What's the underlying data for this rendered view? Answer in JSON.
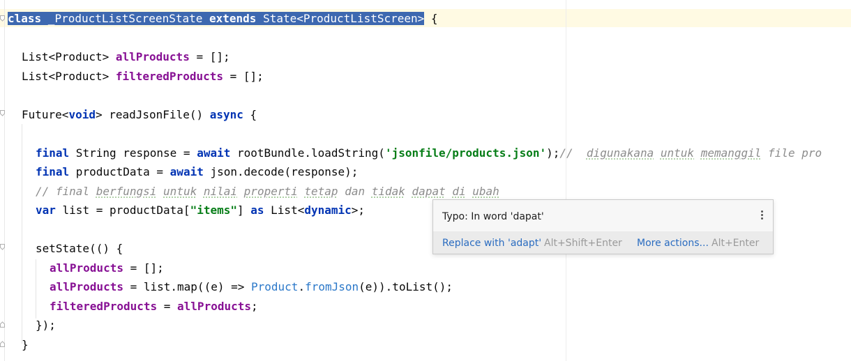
{
  "code": {
    "line1": {
      "kw_class": "class",
      "class_sig": " _ProductListScreenState ",
      "kw_extends": "extends",
      "base": " State<ProductListScreen>",
      "brace": " {"
    },
    "line2": {
      "type": "List<Product> ",
      "name": "allProducts",
      "rest": " = [];"
    },
    "line3": {
      "type": "List<Product> ",
      "name": "filteredProducts",
      "rest": " = [];"
    },
    "line4": {
      "prefix": "Future<",
      "kw_void": "void",
      "mid": "> readJsonFile() ",
      "kw_async": "async",
      "brace": " {"
    },
    "line5": {
      "kw_final": "final",
      "a": " String response = ",
      "kw_await": "await",
      "b": " rootBundle.loadString(",
      "str": "'jsonfile/products.json'",
      "c": ");",
      "comment_slashes": "//  ",
      "w1": "digunakana",
      "sp1": " ",
      "w2": "untuk",
      "sp2": " ",
      "w3": "memanggil",
      "tail": " file pro"
    },
    "line6": {
      "kw_final": "final",
      "a": " productData = ",
      "kw_await": "await",
      "b": " json.decode(response);"
    },
    "line7": {
      "c1": "// final ",
      "w1": "berfungsi",
      "sp1": " ",
      "w2": "untuk",
      "sp2": " ",
      "w3": "nilai",
      "sp3": " ",
      "w4": "properti",
      "sp4": " ",
      "w5": "tetap",
      "sp5": " ",
      "w6": "dan",
      "sp6": " ",
      "w7": "tidak",
      "sp7": " ",
      "w8": "dapat",
      "sp8": " ",
      "w9": "di",
      "sp9": " ",
      "w10": "ubah"
    },
    "line8": {
      "kw_var": "var",
      "a": " list = productData[",
      "str": "\"items\"",
      "b": "] ",
      "kw_as": "as",
      "c": " List<",
      "kw_dynamic": "dynamic",
      "d": ">;"
    },
    "line9": {
      "text": "setState(() {"
    },
    "line10": {
      "name": "allProducts",
      "rest": " = [];"
    },
    "line11": {
      "name": "allProducts",
      "a": " = list.map((e) => ",
      "cls": "Product",
      "dot": ".",
      "method": "fromJson",
      "b": "(e)).toList();"
    },
    "line12": {
      "name": "filteredProducts",
      "a": " = ",
      "name2": "allProducts",
      "b": ";"
    },
    "line13": {
      "text": "});"
    },
    "line14": {
      "text": "}"
    }
  },
  "popup": {
    "title": "Typo: In word 'dapat'",
    "menu_icon": "vertical-ellipsis-icon",
    "action_replace": "Replace with 'adapt'",
    "shortcut_replace": "Alt+Shift+Enter",
    "action_more": "More actions...",
    "shortcut_more": "Alt+Enter"
  },
  "colors": {
    "keyword": "#0033b3",
    "field": "#871094",
    "string": "#067d17",
    "comment": "#8c8c8c",
    "selection": "#3d68b0",
    "link": "#2a6cc0"
  }
}
